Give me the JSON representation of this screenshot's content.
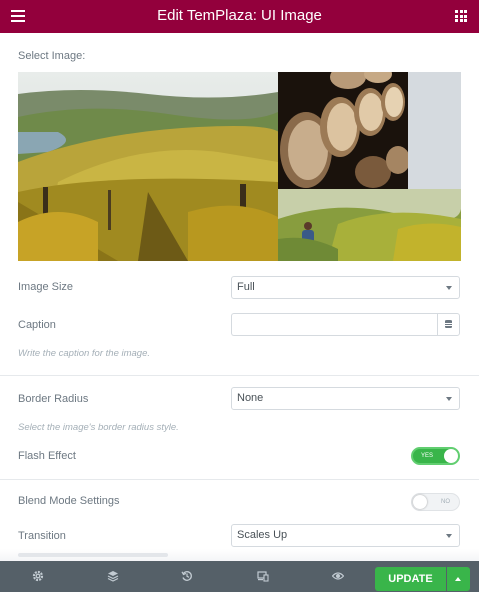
{
  "header": {
    "title": "Edit TemPlaza: UI Image",
    "menu_icon": "hamburger-icon",
    "grid_icon": "apps-grid-icon"
  },
  "panel": {
    "select_image_label": "Select Image:",
    "image_size": {
      "label": "Image Size",
      "value": "Full"
    },
    "caption": {
      "label": "Caption",
      "value": "",
      "help": "Write the caption for the image."
    },
    "border_radius": {
      "label": "Border Radius",
      "value": "None",
      "help": "Select the image's border radius style."
    },
    "flash_effect": {
      "label": "Flash Effect",
      "state": "YES"
    },
    "blend_mode": {
      "label": "Blend Mode Settings",
      "state": "NO"
    },
    "transition": {
      "label": "Transition",
      "value": "Scales Up"
    }
  },
  "footer": {
    "icons": [
      "settings-icon",
      "layers-icon",
      "history-icon",
      "responsive-icon",
      "preview-eye-icon"
    ],
    "update_label": "UPDATE"
  },
  "colors": {
    "brand": "#93003c",
    "accent_green": "#39b54a",
    "footer": "#556068"
  }
}
